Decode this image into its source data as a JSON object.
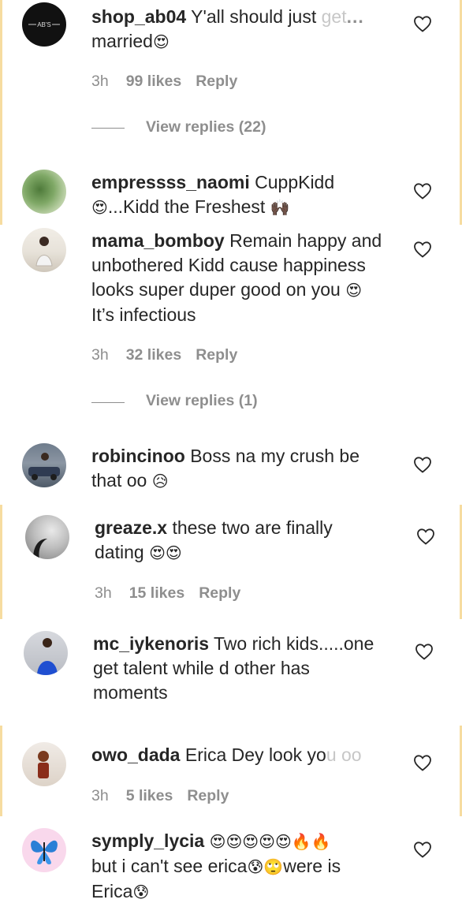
{
  "comments": [
    {
      "username": "shop_ab04",
      "text_prefix": "Y'all should just ",
      "text_fade": "get",
      "text_more": "...",
      "text_line2": "married",
      "emoji": "😍",
      "time": "3h",
      "likes": "99 likes",
      "reply": "Reply",
      "view_replies": "View replies (22)",
      "avatar_text": "AB'S"
    },
    {
      "username": "empressss_naomi",
      "text_line1": "CuppKidd",
      "emoji_start": "😍",
      "text_line2": "...Kidd the Freshest",
      "emoji_end": "🙌🏿"
    },
    {
      "username": "mama_bomboy",
      "text_line1": "Remain happy and",
      "text_line2": "unbothered Kidd cause happiness",
      "text_line3": "looks super duper good on you",
      "emoji": "😍",
      "text_line4": "It’s infectious",
      "time": "3h",
      "likes": "32 likes",
      "reply": "Reply",
      "view_replies": "View replies (1)"
    },
    {
      "username": "robincinoo",
      "text_line1": "Boss na my crush be",
      "text_line2": "that oo",
      "emoji": "😥"
    },
    {
      "username": "greaze.x",
      "text_line1": "these two are finally",
      "text_line2": "dating",
      "emoji": "😍😍",
      "time": "3h",
      "likes": "15 likes",
      "reply": "Reply"
    },
    {
      "username": "mc_iykenoris",
      "text_line1": "Two rich kids.....one",
      "text_line2": "get talent while d other has",
      "text_line3": "moments"
    },
    {
      "username": "owo_dada",
      "text_prefix": "Erica Dey look yo",
      "text_fade": "u oo",
      "time": "3h",
      "likes": "5 likes",
      "reply": "Reply"
    },
    {
      "username": "symply_lycia",
      "emoji_line1": "😍😍😍😍😍🔥🔥",
      "text_line2a": "but i can't see erica",
      "emoji_mid": "😰🙄",
      "text_line2b": "were is",
      "text_line3": "Erica",
      "emoji_end": "😰"
    }
  ],
  "colors": {
    "text": "#262626",
    "meta": "#8e8e8e",
    "edge": "#f6dca0"
  },
  "icons": [
    "heart-icon"
  ]
}
